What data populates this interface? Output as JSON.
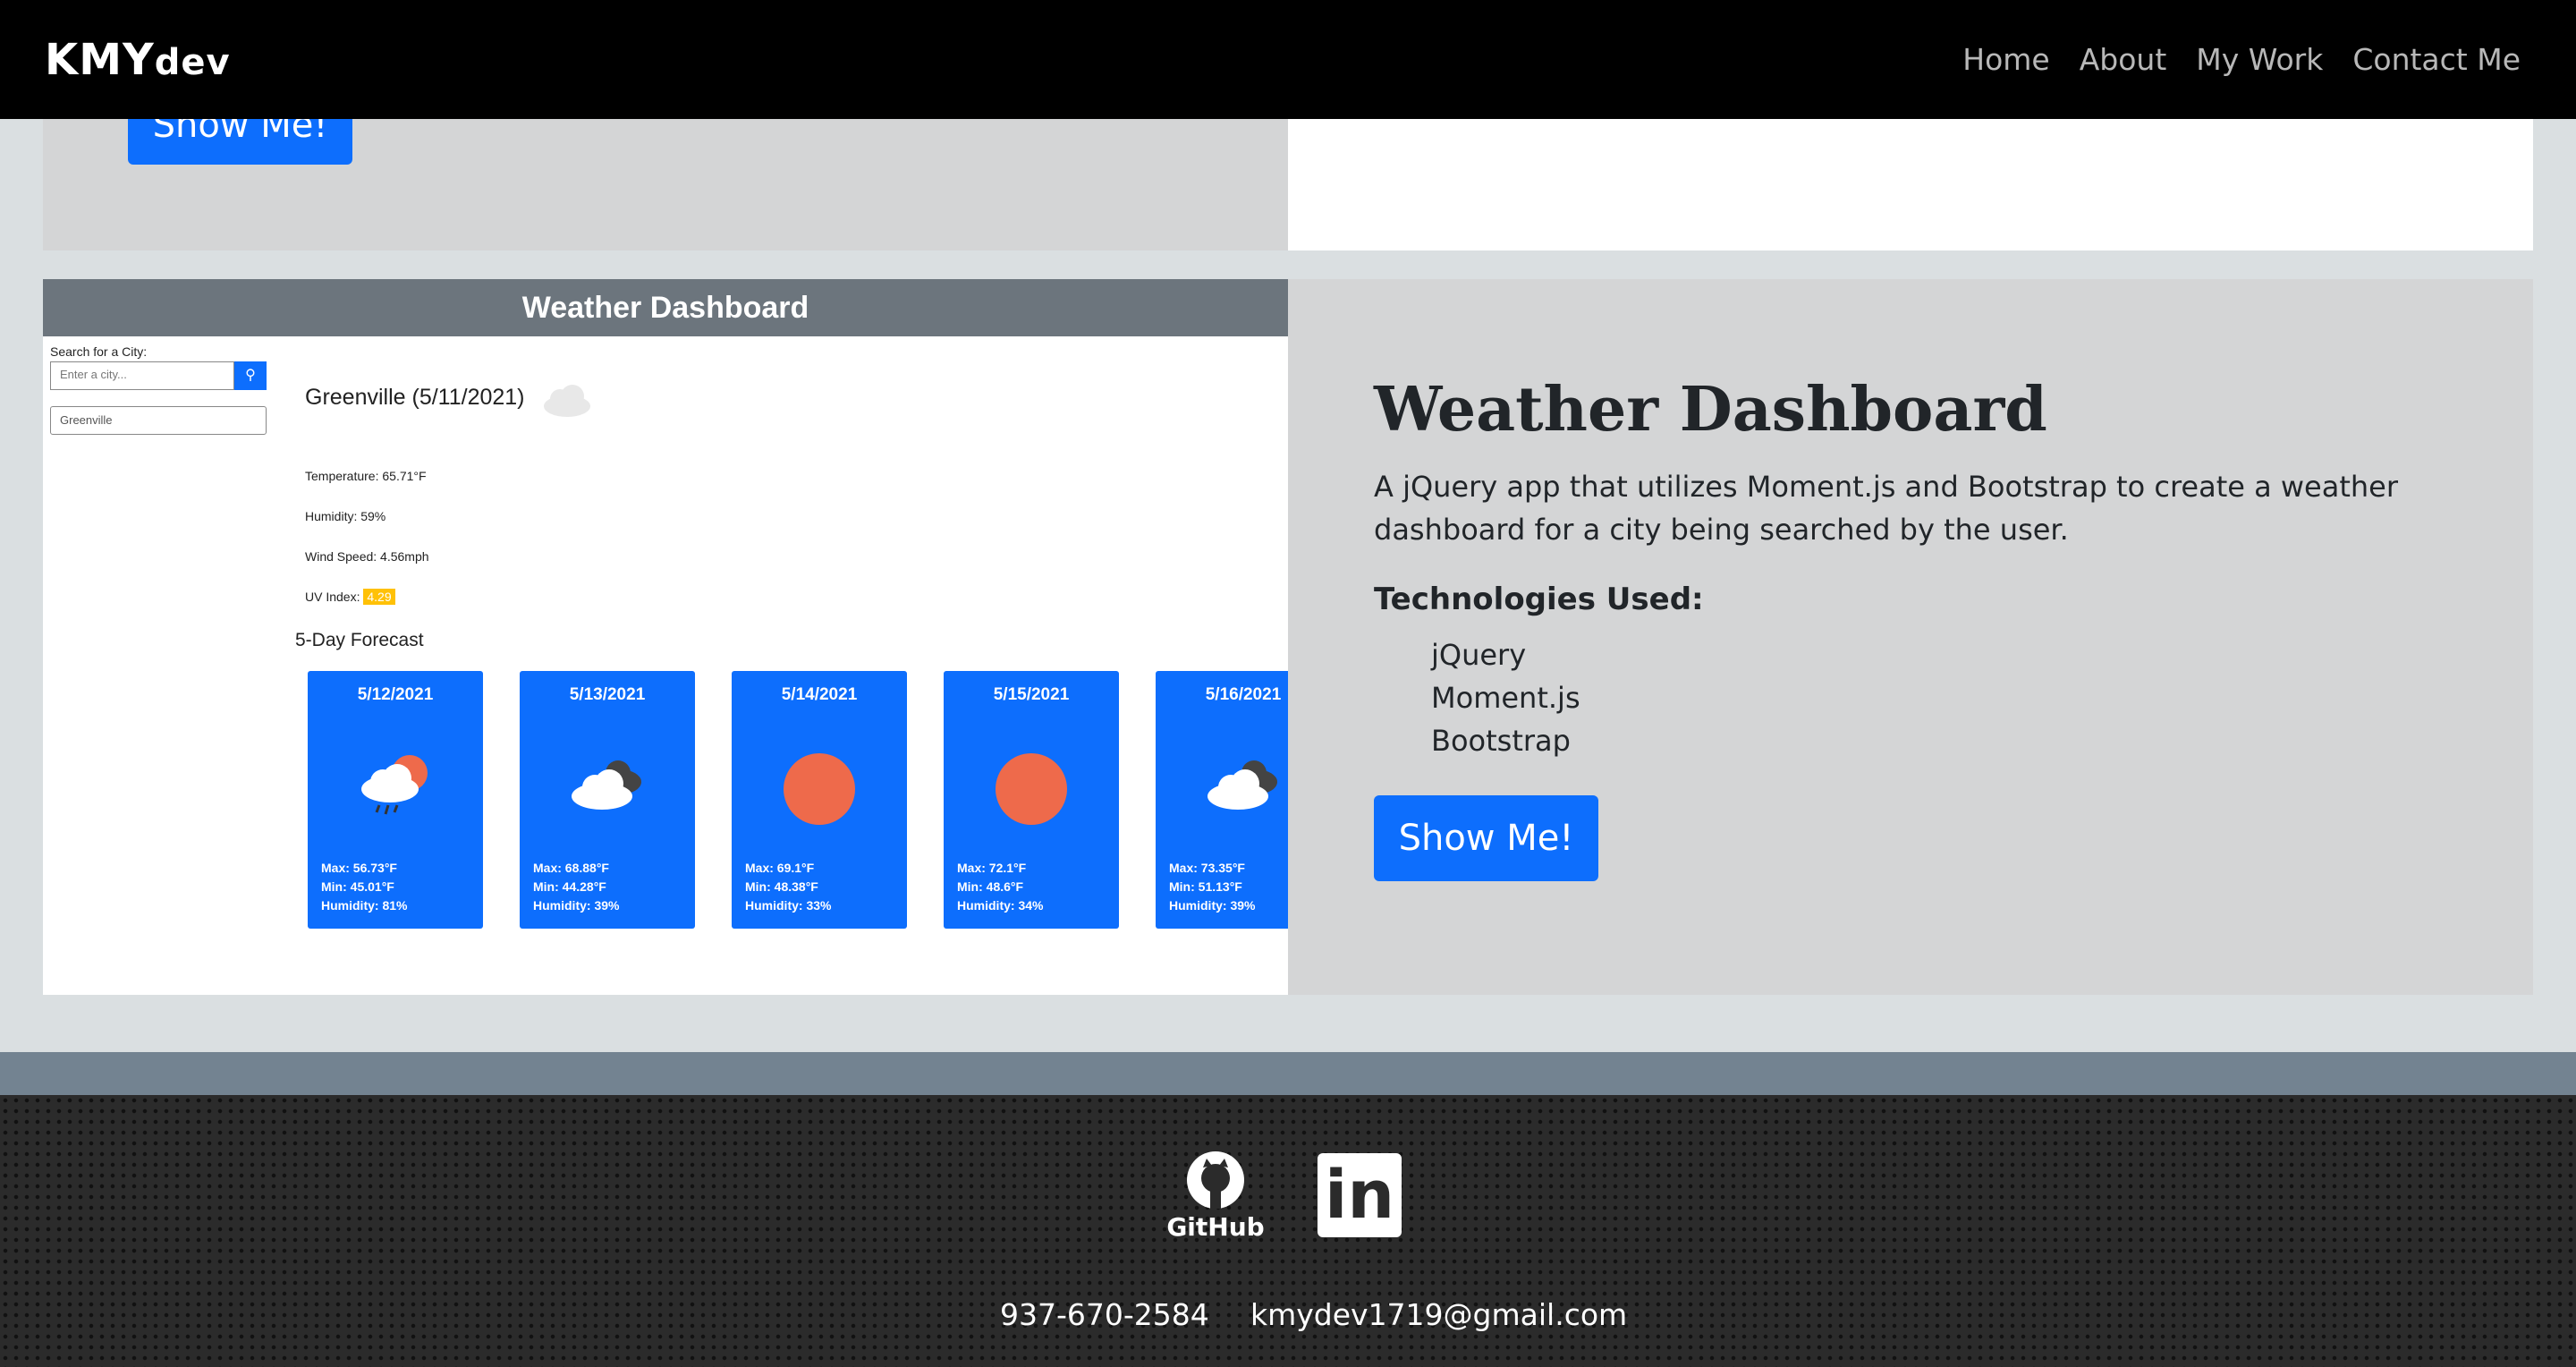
{
  "navbar": {
    "brand_main": "KMY",
    "brand_small": "dev",
    "links": [
      "Home",
      "About",
      "My Work",
      "Contact Me"
    ]
  },
  "top_card": {
    "button_label": "Show Me!"
  },
  "project": {
    "title": "Weather Dashboard",
    "description": "A jQuery app that utilizes Moment.js and Bootstrap to create a weather dashboard for a city being searched by the user.",
    "tech_heading": "Technologies Used:",
    "technologies": [
      "jQuery",
      "Moment.js",
      "Bootstrap"
    ],
    "button_label": "Show Me!"
  },
  "screenshot": {
    "header": "Weather Dashboard",
    "search_label": "Search for a City:",
    "search_placeholder": "Enter a city...",
    "history_item": "Greenville",
    "city_line": "Greenville (5/11/2021)",
    "temperature": "Temperature: 65.71°F",
    "humidity": "Humidity: 59%",
    "wind": "Wind Speed: 4.56mph",
    "uv_label": "UV Index:",
    "uv_value": "4.29",
    "forecast_title": "5-Day Forecast",
    "forecast": [
      {
        "date": "5/12/2021",
        "max": "Max: 56.73°F",
        "min": "Min: 45.01°F",
        "humidity": "Humidity: 81%",
        "icon": "rain-sun-icon"
      },
      {
        "date": "5/13/2021",
        "max": "Max: 68.88°F",
        "min": "Min: 44.28°F",
        "humidity": "Humidity: 39%",
        "icon": "cloudy-icon"
      },
      {
        "date": "5/14/2021",
        "max": "Max: 69.1°F",
        "min": "Min: 48.38°F",
        "humidity": "Humidity: 33%",
        "icon": "sun-icon"
      },
      {
        "date": "5/15/2021",
        "max": "Max: 72.1°F",
        "min": "Min: 48.6°F",
        "humidity": "Humidity: 34%",
        "icon": "sun-icon"
      },
      {
        "date": "5/16/2021",
        "max": "Max: 73.35°F",
        "min": "Min: 51.13°F",
        "humidity": "Humidity: 39%",
        "icon": "cloudy-icon"
      }
    ]
  },
  "footer": {
    "github_label": "GitHub",
    "linkedin_label": "in",
    "phone": "937-670-2584",
    "email": "kmydev1719@gmail.com"
  },
  "colors": {
    "primary": "#0d6efd",
    "navbar": "#000000",
    "card_gray": "#d4d5d6",
    "header_gray": "#6c757d",
    "uv_badge": "#ffc107",
    "sun": "#ee6a4b"
  }
}
